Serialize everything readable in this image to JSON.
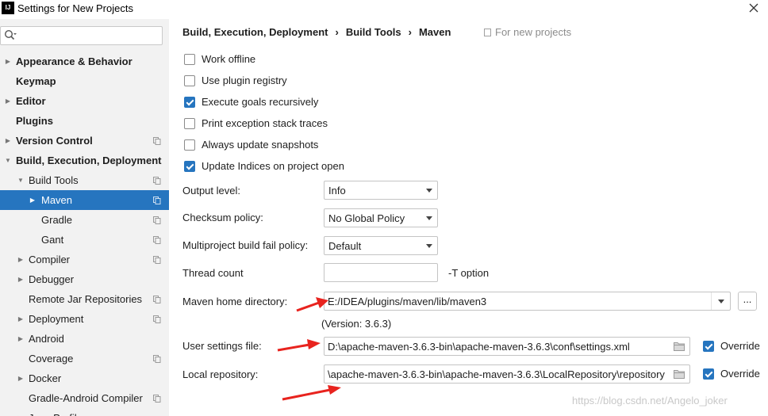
{
  "window": {
    "title": "Settings for New Projects",
    "app_icon_text": "IJ"
  },
  "search": {
    "value": "",
    "placeholder": ""
  },
  "sidebar": {
    "items": [
      {
        "label": "Appearance & Behavior",
        "indent": 0,
        "expander": "right",
        "bold": true
      },
      {
        "label": "Keymap",
        "indent": 0,
        "expander": "",
        "bold": true
      },
      {
        "label": "Editor",
        "indent": 0,
        "expander": "right",
        "bold": true
      },
      {
        "label": "Plugins",
        "indent": 0,
        "expander": "",
        "bold": true
      },
      {
        "label": "Version Control",
        "indent": 0,
        "expander": "right",
        "bold": true,
        "copy": true
      },
      {
        "label": "Build, Execution, Deployment",
        "indent": 0,
        "expander": "down",
        "bold": true
      },
      {
        "label": "Build Tools",
        "indent": 1,
        "expander": "down",
        "bold": false,
        "copy": true
      },
      {
        "label": "Maven",
        "indent": 2,
        "expander": "right",
        "bold": false,
        "copy": true,
        "selected": true
      },
      {
        "label": "Gradle",
        "indent": 3,
        "expander": "",
        "bold": false,
        "copy": true
      },
      {
        "label": "Gant",
        "indent": 3,
        "expander": "",
        "bold": false,
        "copy": true
      },
      {
        "label": "Compiler",
        "indent": 1,
        "expander": "right",
        "bold": false,
        "copy": true
      },
      {
        "label": "Debugger",
        "indent": 1,
        "expander": "right",
        "bold": false
      },
      {
        "label": "Remote Jar Repositories",
        "indent": 1,
        "expander": "",
        "bold": false,
        "copy": true
      },
      {
        "label": "Deployment",
        "indent": 1,
        "expander": "right",
        "bold": false,
        "copy": true
      },
      {
        "label": "Android",
        "indent": 1,
        "expander": "right",
        "bold": false
      },
      {
        "label": "Coverage",
        "indent": 1,
        "expander": "",
        "bold": false,
        "copy": true
      },
      {
        "label": "Docker",
        "indent": 1,
        "expander": "right",
        "bold": false
      },
      {
        "label": "Gradle-Android Compiler",
        "indent": 1,
        "expander": "",
        "bold": false,
        "copy": true
      },
      {
        "label": "Java Profiler",
        "indent": 1,
        "expander": "right",
        "bold": false
      }
    ]
  },
  "breadcrumb": {
    "parts": [
      "Build, Execution, Deployment",
      "Build Tools",
      "Maven"
    ],
    "separator": "›",
    "scope_note": "For new projects"
  },
  "checkboxes": [
    {
      "label": "Work offline",
      "checked": false
    },
    {
      "label": "Use plugin registry",
      "checked": false
    },
    {
      "label": "Execute goals recursively",
      "checked": true
    },
    {
      "label": "Print exception stack traces",
      "checked": false
    },
    {
      "label": "Always update snapshots",
      "checked": false
    },
    {
      "label": "Update Indices on project open",
      "checked": true
    }
  ],
  "fields": {
    "output_level": {
      "label": "Output level:",
      "value": "Info"
    },
    "checksum_policy": {
      "label": "Checksum policy:",
      "value": "No Global Policy"
    },
    "multiproject_fail": {
      "label": "Multiproject build fail policy:",
      "value": "Default"
    },
    "thread_count": {
      "label": "Thread count",
      "value": "",
      "suffix": "-T option"
    },
    "maven_home": {
      "label": "Maven home directory:",
      "value": "E:/IDEA/plugins/maven/lib/maven3",
      "browse_label": "...",
      "version": "(Version: 3.6.3)"
    },
    "user_settings": {
      "label": "User settings file:",
      "value": "D:\\apache-maven-3.6.3-bin\\apache-maven-3.6.3\\conf\\settings.xml",
      "override_label": "Override",
      "override_checked": true
    },
    "local_repo": {
      "label": "Local repository:",
      "value": "\\apache-maven-3.6.3-bin\\apache-maven-3.6.3\\LocalRepository\\repository",
      "override_label": "Override",
      "override_checked": true
    }
  },
  "watermark": "https://blog.csdn.net/Angelo_joker",
  "colors": {
    "accent": "#2675bf",
    "sidebar_bg": "#f2f2f2",
    "annotation_red": "#e8231e"
  }
}
